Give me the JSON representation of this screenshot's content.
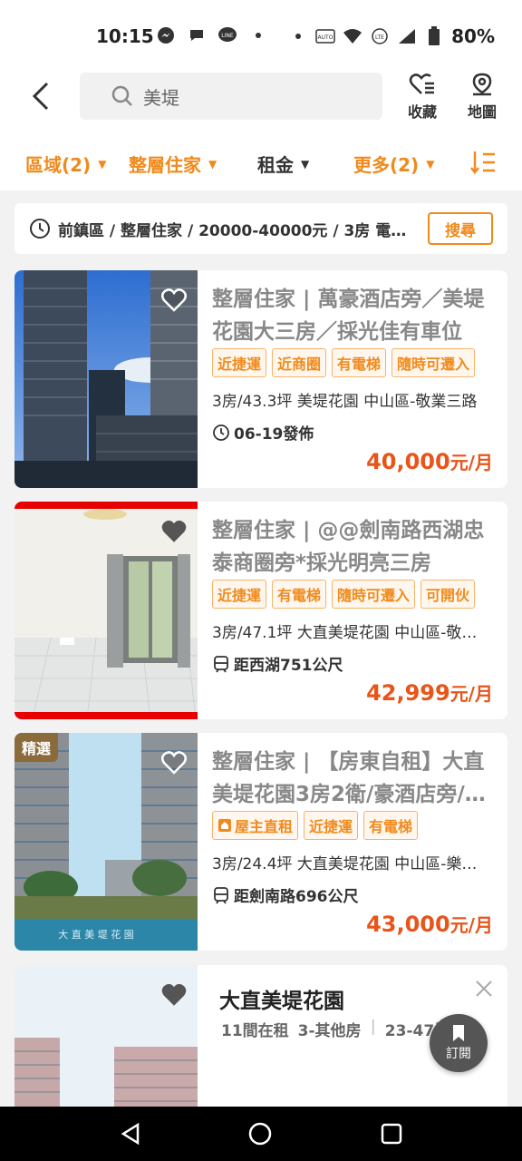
{
  "status": {
    "time": "10:15",
    "battery": "80%"
  },
  "header": {
    "search_text": "美堤",
    "favorites_label": "收藏",
    "map_label": "地圖"
  },
  "filters": [
    {
      "label": "區域(2)",
      "active": true
    },
    {
      "label": "整層住家",
      "active": true
    },
    {
      "label": "租金",
      "active": false
    },
    {
      "label": "更多(2)",
      "active": true
    }
  ],
  "saved_search": {
    "text": "前鎮區 / 整層住家 / 20000-40000元 / 3房 電…",
    "button": "搜尋"
  },
  "listings": [
    {
      "title": "整層住家 | 萬豪酒店旁／美堤花園大三房／採光佳有車位",
      "tags": [
        "近捷運",
        "近商圈",
        "有電梯",
        "隨時可遷入"
      ],
      "meta": "3房/43.3坪  美堤花園 中山區-敬業三路",
      "sub": "06-19發佈",
      "sub_icon": "clock-icon",
      "price": "40,000",
      "unit": "元/月"
    },
    {
      "title": "整層住家 | @@劍南路西湖忠泰商圈旁*採光明亮三房",
      "tags": [
        "近捷運",
        "有電梯",
        "隨時可遷入",
        "可開伙"
      ],
      "meta": "3房/47.1坪  大直美堤花園 中山區-敬…",
      "sub": "距西湖751公尺",
      "sub_icon": "metro-icon",
      "price": "42,999",
      "unit": "元/月"
    },
    {
      "badge": "精選",
      "title": "整層住家 | 【房東自租】大直美堤花園3房2衛/豪酒店旁/…",
      "tags": [
        "屋主直租",
        "近捷運",
        "有電梯"
      ],
      "meta": "3房/24.4坪  大直美堤花園 中山區-樂…",
      "sub": "距劍南路696公尺",
      "sub_icon": "metro-icon",
      "price": "43,000",
      "unit": "元/月"
    }
  ],
  "community": {
    "name": "大直美堤花園",
    "count": "11間在租",
    "type": "3-其他房",
    "size": "23-47坪",
    "subscribe_label": "訂閱"
  },
  "colors": {
    "accent": "#f08a1c",
    "price": "#e8541a"
  }
}
